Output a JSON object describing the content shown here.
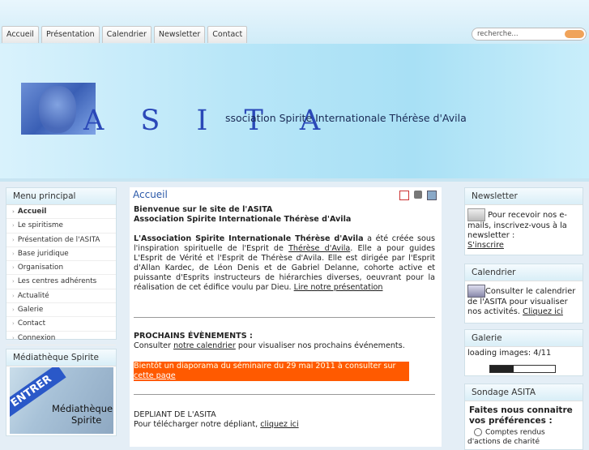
{
  "nav": {
    "items": [
      "Accueil",
      "Présentation",
      "Calendrier",
      "Newsletter",
      "Contact"
    ],
    "search_placeholder": "recherche..."
  },
  "banner": {
    "logo": "A S I T A",
    "subtitle": "ssociation Spirite Internationale Thérèse d'Avila"
  },
  "menu": {
    "title": "Menu principal",
    "items": [
      "Accueil",
      "Le spiritisme",
      "Présentation de l'ASITA",
      "Base juridique",
      "Organisation",
      "Les centres adhérents",
      "Actualité",
      "Galerie",
      "Contact",
      "Connexion"
    ]
  },
  "mediatheque": {
    "title": "Médiathèque Spirite",
    "ribbon": "ENTRER",
    "line1": "Médiathèque",
    "line2": "Spirite"
  },
  "content": {
    "title": "Accueil",
    "welcome1": "Bienvenue sur le site de l'ASITA",
    "welcome2": "Association Spirite Internationale Thérèse d'Avila",
    "intro_bold": "L'Association Spirite Internationale Thérèse d'Avila",
    "intro_text": " a été créée sous l'inspiration spirituelle de l'Esprit de ",
    "intro_link": "Thérèse d'Avila",
    "intro_text2": ". Elle a pour guides L'Esprit de Vérité et l'Esprit de Thérèse d'Avila. Elle est dirigée par l'Esprit d'Allan Kardec, de Léon Denis et de Gabriel Delanne, cohorte active et puissante d'Esprits instructeurs de hiérarchies diverses, oeuvrant pour la réalisation de cet édifice voulu par Dieu. ",
    "intro_more": "Lire notre présentation",
    "events_title": "PROCHAINS ÉVÈNEMENTS :",
    "events_pre": "Consulter ",
    "events_link": "notre calendrier",
    "events_post": " pour visualiser nos prochains événements.",
    "highlight_pre": "Bientôt un diaporama du séminaire du 29 mai 2011 à consulter sur ",
    "highlight_link": "cette  page",
    "depliant_title": "DEPLIANT DE L'ASITA",
    "depliant_pre": "Pour télécharger notre dépliant, ",
    "depliant_link": "cliquez ici"
  },
  "newsletter": {
    "title": "Newsletter",
    "text": "Pour recevoir nos e-mails, inscrivez-vous à la newsletter :",
    "link": "S'inscrire"
  },
  "calendrier": {
    "title": "Calendrier",
    "text": "Consulter le calendrier de l'ASITA pour visualiser nos activités. ",
    "link": "Cliquez ici"
  },
  "galerie": {
    "title": "Galerie",
    "loading": "loading images: 4/11",
    "progress": 0.36
  },
  "sondage": {
    "title": "Sondage ASITA",
    "question": "Faites nous connaitre vos préférences :",
    "option1": "Comptes rendus d'actions de charité"
  }
}
